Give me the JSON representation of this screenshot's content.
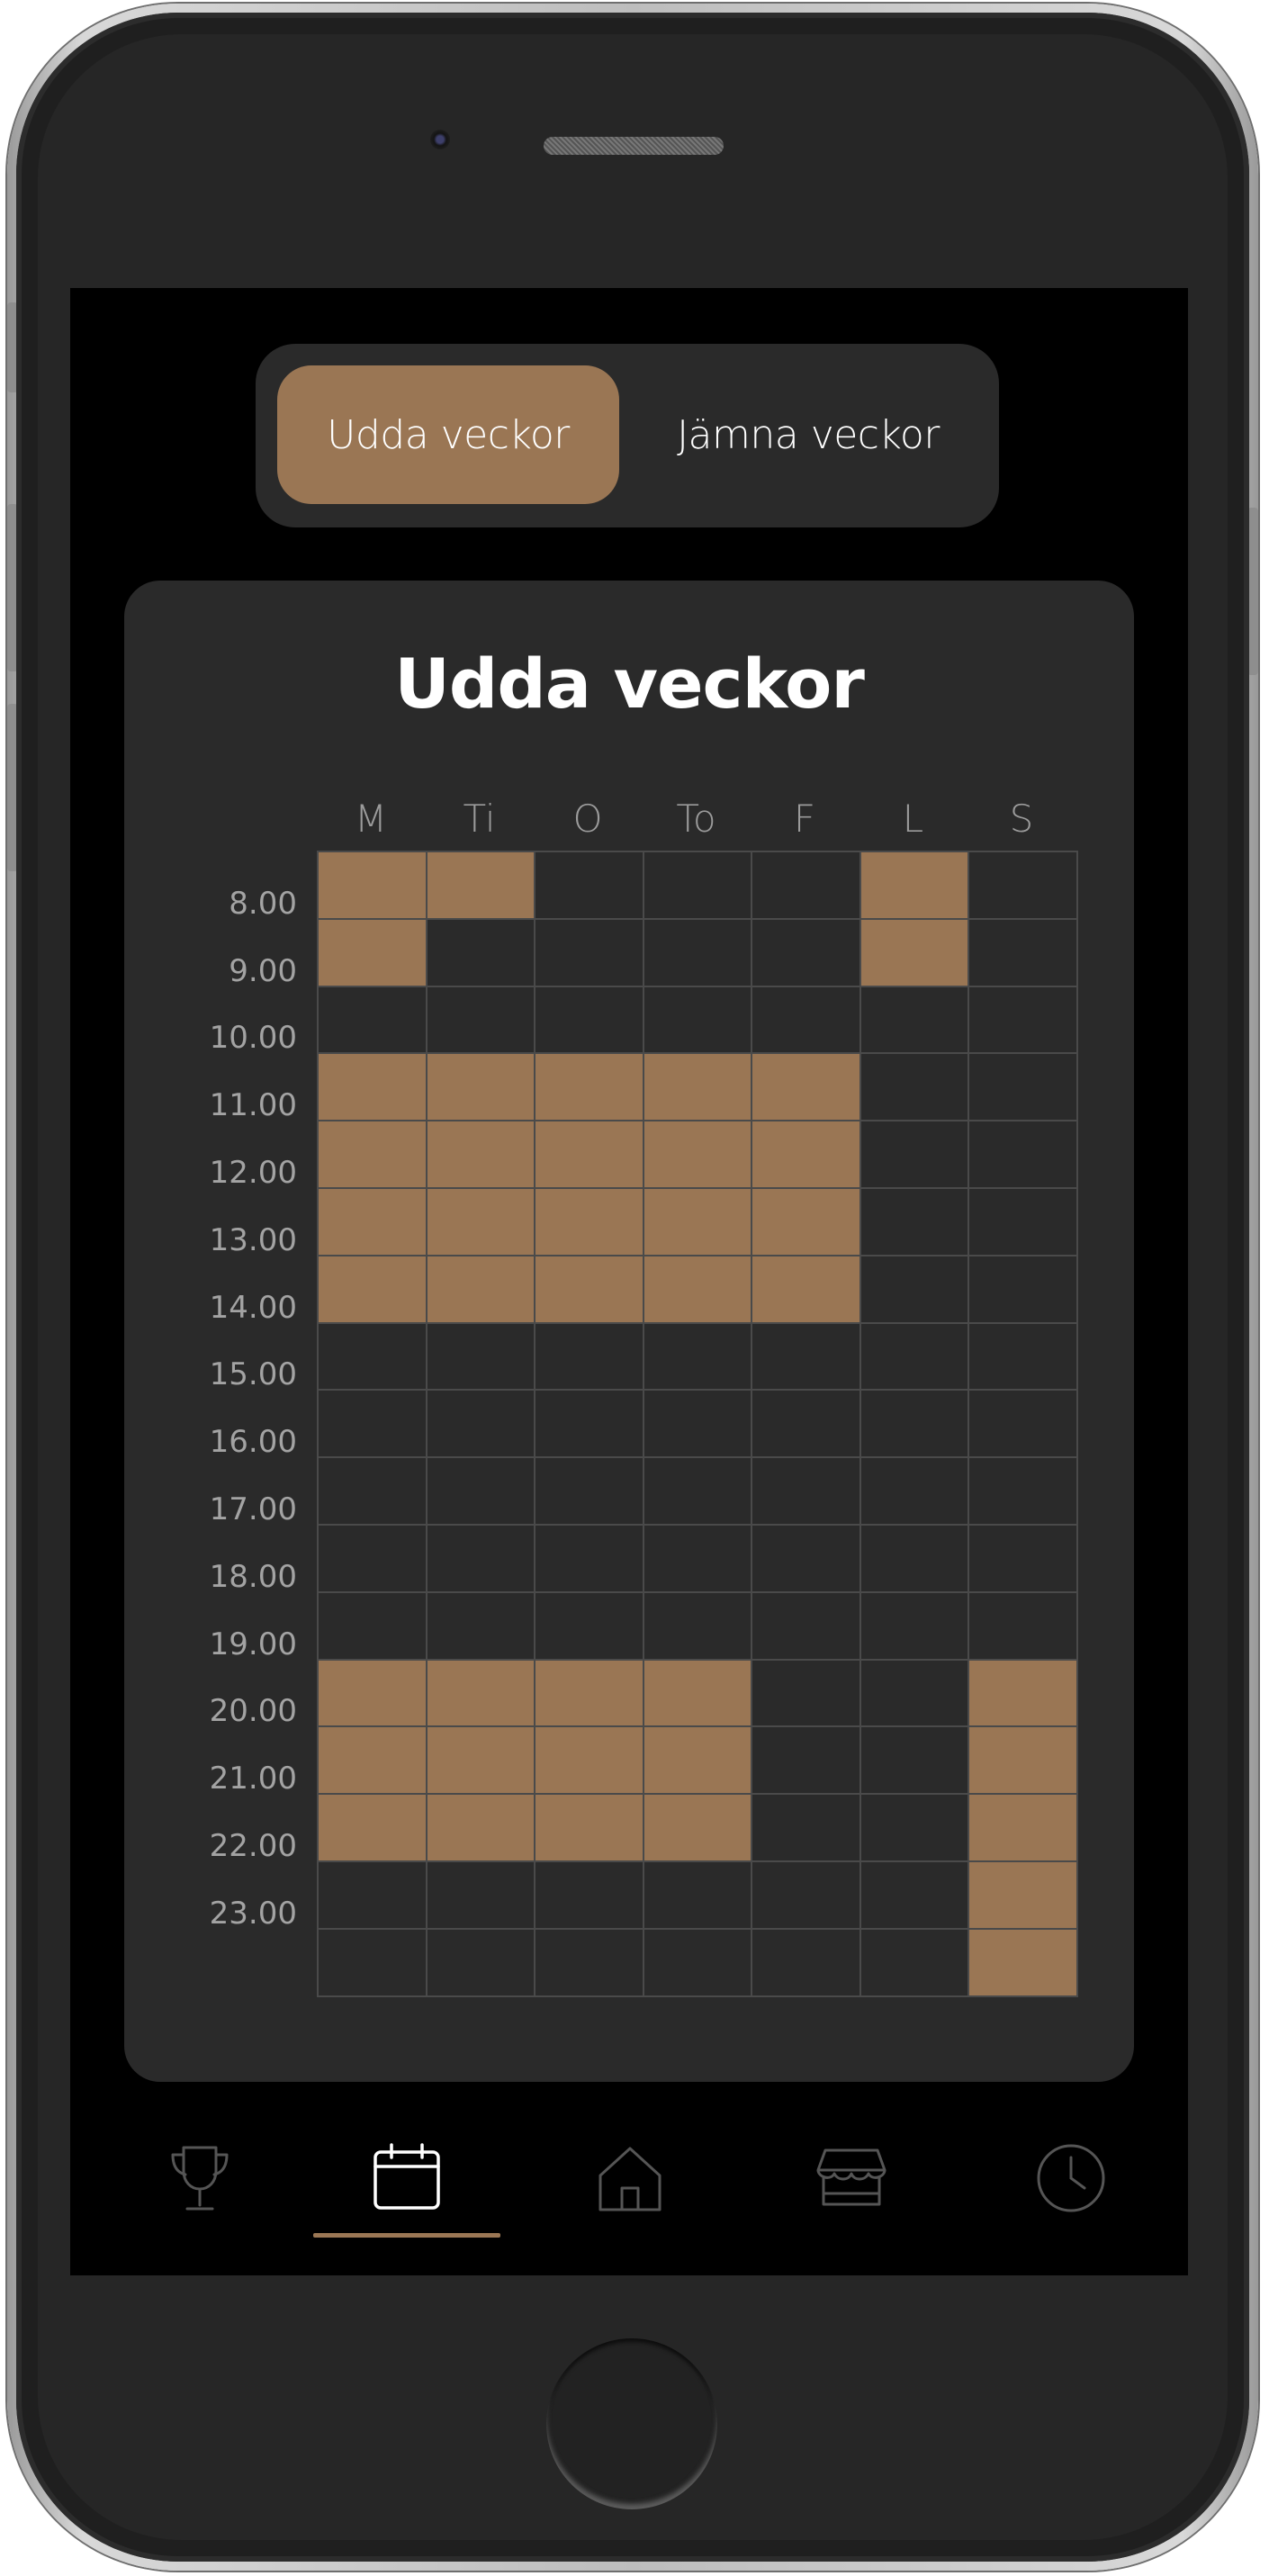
{
  "toggle": {
    "odd_label": "Udda veckor",
    "even_label": "Jämna veckor",
    "selected": "odd"
  },
  "schedule": {
    "title": "Udda veckor",
    "days": [
      "M",
      "Ti",
      "O",
      "To",
      "F",
      "L",
      "S"
    ],
    "hours": [
      "8.00",
      "9.00",
      "10.00",
      "11.00",
      "12.00",
      "13.00",
      "14.00",
      "15.00",
      "16.00",
      "17.00",
      "18.00",
      "19.00",
      "20.00",
      "21.00",
      "22.00",
      "23.00"
    ],
    "rows": [
      [
        1,
        1,
        0,
        0,
        0,
        1,
        0
      ],
      [
        1,
        0,
        0,
        0,
        0,
        1,
        0
      ],
      [
        0,
        0,
        0,
        0,
        0,
        0,
        0
      ],
      [
        1,
        1,
        1,
        1,
        1,
        0,
        0
      ],
      [
        1,
        1,
        1,
        1,
        1,
        0,
        0
      ],
      [
        1,
        1,
        1,
        1,
        1,
        0,
        0
      ],
      [
        1,
        1,
        1,
        1,
        1,
        0,
        0
      ],
      [
        0,
        0,
        0,
        0,
        0,
        0,
        0
      ],
      [
        0,
        0,
        0,
        0,
        0,
        0,
        0
      ],
      [
        0,
        0,
        0,
        0,
        0,
        0,
        0
      ],
      [
        0,
        0,
        0,
        0,
        0,
        0,
        0
      ],
      [
        0,
        0,
        0,
        0,
        0,
        0,
        0
      ],
      [
        1,
        1,
        1,
        1,
        0,
        0,
        1
      ],
      [
        1,
        1,
        1,
        1,
        0,
        0,
        1
      ],
      [
        1,
        1,
        1,
        1,
        0,
        0,
        1
      ],
      [
        0,
        0,
        0,
        0,
        0,
        0,
        1
      ],
      [
        0,
        0,
        0,
        0,
        0,
        0,
        1
      ]
    ]
  },
  "nav": {
    "items": [
      {
        "icon": "trophy-icon",
        "active": false
      },
      {
        "icon": "calendar-icon",
        "active": true
      },
      {
        "icon": "home-icon",
        "active": false
      },
      {
        "icon": "store-icon",
        "active": false
      },
      {
        "icon": "clock-icon",
        "active": false
      }
    ]
  },
  "colors": {
    "accent": "#9a7654",
    "card": "#2a2a2a",
    "background": "#000000"
  }
}
